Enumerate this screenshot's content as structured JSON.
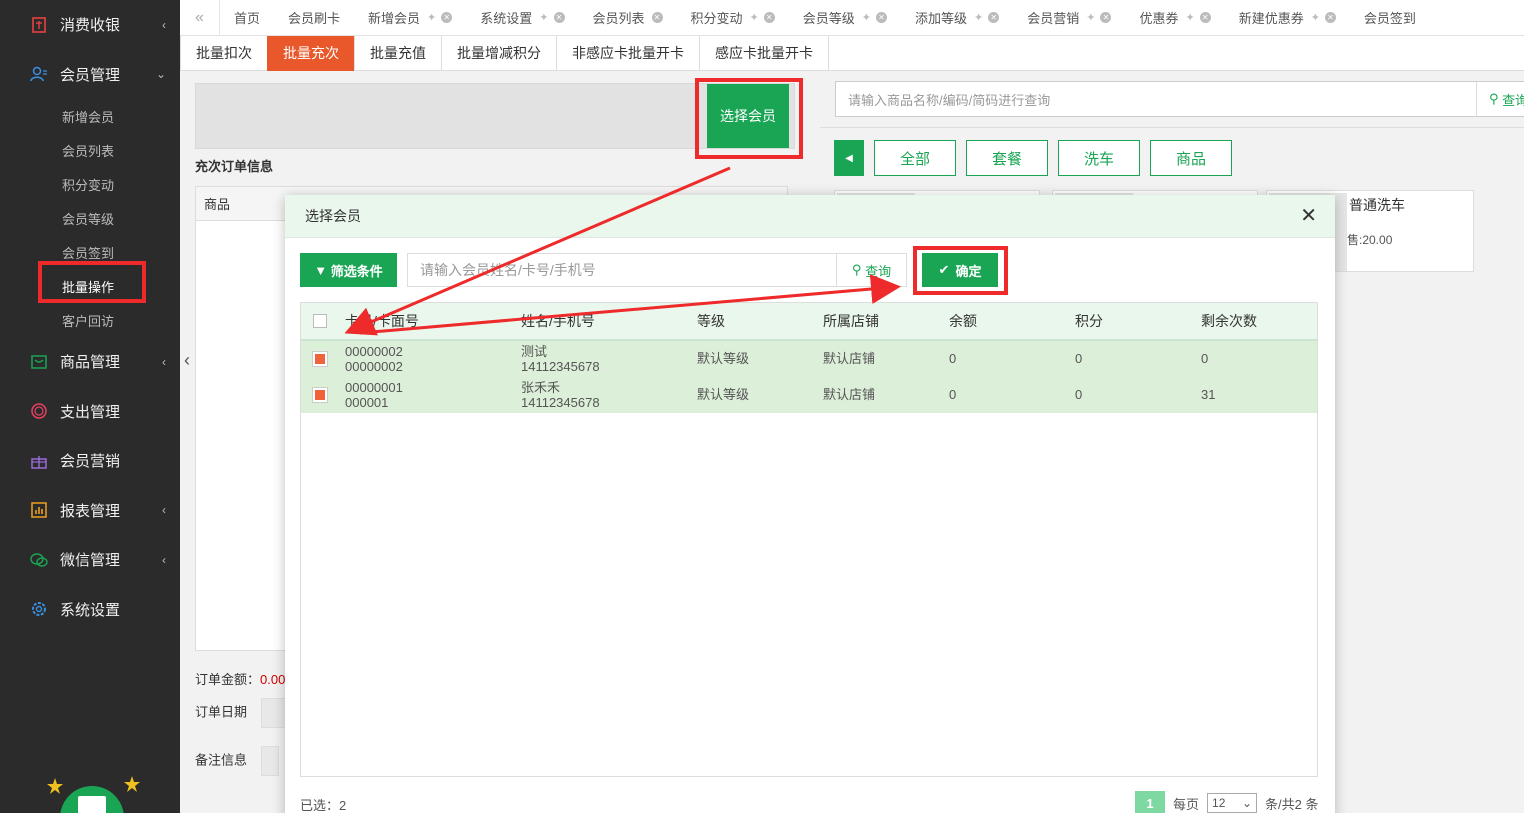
{
  "sidebar": {
    "items": [
      {
        "label": "消费收银",
        "icon": "cashier-icon",
        "arrow": "‹"
      },
      {
        "label": "会员管理",
        "icon": "member-icon",
        "arrow": "⌄"
      },
      {
        "label": "商品管理",
        "icon": "goods-icon",
        "arrow": "‹"
      },
      {
        "label": "支出管理",
        "icon": "expense-icon",
        "arrow": ""
      },
      {
        "label": "会员营销",
        "icon": "gift-icon",
        "arrow": ""
      },
      {
        "label": "报表管理",
        "icon": "report-icon",
        "arrow": "‹"
      },
      {
        "label": "微信管理",
        "icon": "wechat-icon",
        "arrow": "‹"
      },
      {
        "label": "系统设置",
        "icon": "gear-icon",
        "arrow": ""
      }
    ],
    "sub_items": [
      "新增会员",
      "会员列表",
      "积分变动",
      "会员等级",
      "会员签到",
      "批量操作",
      "客户回访"
    ]
  },
  "top_tabs": [
    "首页",
    "会员刷卡",
    "新增会员",
    "系统设置",
    "会员列表",
    "积分变动",
    "会员等级",
    "添加等级",
    "会员营销",
    "优惠券",
    "新建优惠券",
    "会员签到"
  ],
  "sub_tabs": [
    "批量扣次",
    "批量充次",
    "批量充值",
    "批量增减积分",
    "非感应卡批量开卡",
    "感应卡批量开卡"
  ],
  "left": {
    "select_member": "选择会员",
    "order_info": "充次订单信息",
    "col_goods": "商品",
    "order_amount_label": "订单金额：",
    "order_amount_value": "0.00",
    "order_date_label": "订单日期",
    "remark_label": "备注信息"
  },
  "right": {
    "search_placeholder": "请输入商品名称/编码/简码进行查询",
    "search_btn": "查询",
    "categories": [
      "全部",
      "套餐",
      "洗车",
      "商品"
    ],
    "product_name": "普通洗车",
    "product_price": "售:20.00"
  },
  "modal": {
    "title": "选择会员",
    "filter_btn": "筛选条件",
    "search_placeholder": "请输入会员姓名/卡号/手机号",
    "search_btn": "查询",
    "confirm_btn": "确定",
    "columns": [
      "卡号/卡面号",
      "姓名/手机号",
      "等级",
      "所属店铺",
      "余额",
      "积分",
      "剩余次数"
    ],
    "rows": [
      {
        "card": "00000002",
        "face": "00000002",
        "name": "测试",
        "phone": "14112345678",
        "level": "默认等级",
        "shop": "默认店铺",
        "balance": "0",
        "points": "0",
        "times": "0"
      },
      {
        "card": "00000001",
        "face": "000001",
        "name": "张禾禾",
        "phone": "14112345678",
        "level": "默认等级",
        "shop": "默认店铺",
        "balance": "0",
        "points": "0",
        "times": "31"
      }
    ],
    "selected_label": "已选：2",
    "page": "1",
    "per_page_label": "每页",
    "per_page_value": "12",
    "total_label": "条/共2 条"
  },
  "colors": {
    "green": "#1aa554",
    "orange": "#e8582a",
    "highlight": "#ee2a2a"
  }
}
